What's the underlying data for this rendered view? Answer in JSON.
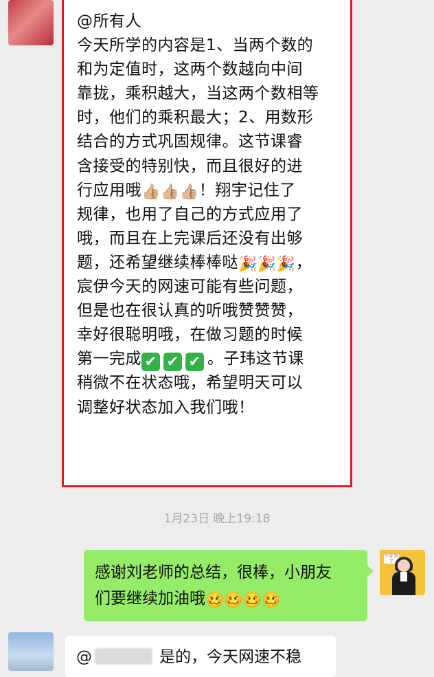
{
  "messages": [
    {
      "side": "left",
      "lines": [
        "@所有人",
        "今天所学的内容是1、当两个数的",
        "和为定值时，这两个数越向中间",
        "靠拢，乘积越大，当这两个数相等",
        "时，他们的乘积最大；2、用数形",
        "结合的方式巩固规律。这节课睿",
        "含接受的特别快，而且很好的进",
        "行应用哦",
        "！翔宇记住了",
        "规律，也用了自己的方式应用了",
        "哦，而且在上完课后还没有出够",
        "题，还希望继续棒棒哒",
        "，",
        "宸伊今天的网速可能有些问题，",
        "但是也在很认真的听哦赞赞赞，",
        "幸好很聪明哦，在做习题的时候",
        "第一完成",
        "。子玮这节课",
        "稍微不在状态哦，希望明天可以",
        "调整好状态加入我们哦！"
      ],
      "emoji": {
        "thumbs": "👍🏼👍🏼👍🏼",
        "party": "🎉🎉🎉",
        "check": "✔"
      }
    }
  ],
  "timestamp": "1月23日 晚上19:18",
  "reply": {
    "line1": "感谢刘老师的总结，很棒，小朋友",
    "line2": "们要继续加油哦",
    "emoji": "🥴🥴🥴🥴"
  },
  "bottom": {
    "at": "@",
    "text": "是的，今天网速不稳"
  },
  "avatar_right_label": "牛课 数学",
  "colors": {
    "highlight_border": "#e01b24",
    "reply_bubble": "#95ec69",
    "background": "#ededed"
  }
}
